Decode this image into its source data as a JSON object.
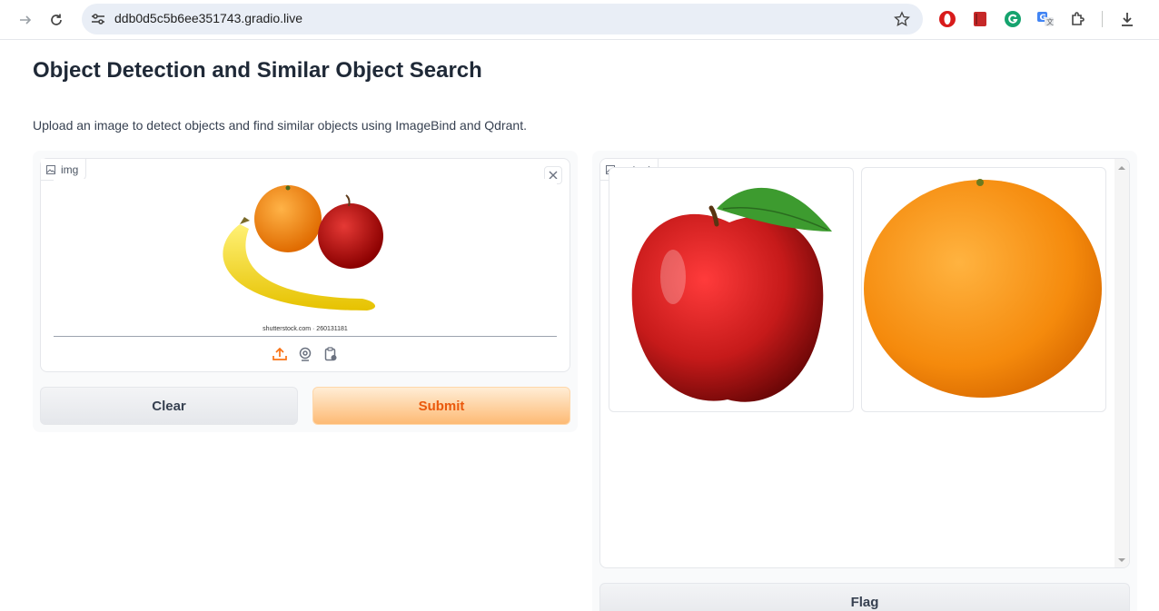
{
  "browser": {
    "url": "ddb0d5c5b6ee351743.gradio.live",
    "icons": [
      "forward-arrow-icon",
      "reload-icon",
      "site-settings-icon",
      "bookmark-star-icon",
      "opera-extension-icon",
      "book-extension-icon",
      "grammarly-extension-icon",
      "translate-extension-icon",
      "extensions-puzzle-icon",
      "download-icon"
    ]
  },
  "page": {
    "title": "Object Detection and Similar Object Search",
    "description": "Upload an image to detect objects and find similar objects using ImageBind and Qdrant."
  },
  "input": {
    "label": "img",
    "watermark": "shutterstock.com · 260131181",
    "sources": [
      "upload-icon",
      "webcam-icon",
      "clipboard-icon"
    ]
  },
  "buttons": {
    "clear": "Clear",
    "submit": "Submit",
    "flag": "Flag"
  },
  "output": {
    "label": "output",
    "images": [
      "apple",
      "orange"
    ]
  },
  "colors": {
    "accent": "#ea580c",
    "submit_bg": "#fdba74",
    "panel_bg": "#f9fafb"
  }
}
